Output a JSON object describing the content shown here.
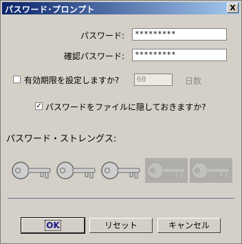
{
  "window": {
    "title": "パスワード･プロンプト",
    "close_glyph": "X"
  },
  "form": {
    "password_label": "パスワード:",
    "password_value": "*********",
    "confirm_label": "確認パスワード:",
    "confirm_value": "*********"
  },
  "expiry": {
    "label": "有効期限を設定しますか?",
    "checked": false,
    "days_value": "60",
    "days_unit": "日数"
  },
  "hide": {
    "label": "パスワードをファイルに隠しておきますか?",
    "checked": true
  },
  "strength": {
    "label": "パスワード・ストレングス:",
    "level": 3,
    "max": 5
  },
  "buttons": {
    "ok": "OK",
    "reset": "リセット",
    "cancel": "キャンセル"
  }
}
